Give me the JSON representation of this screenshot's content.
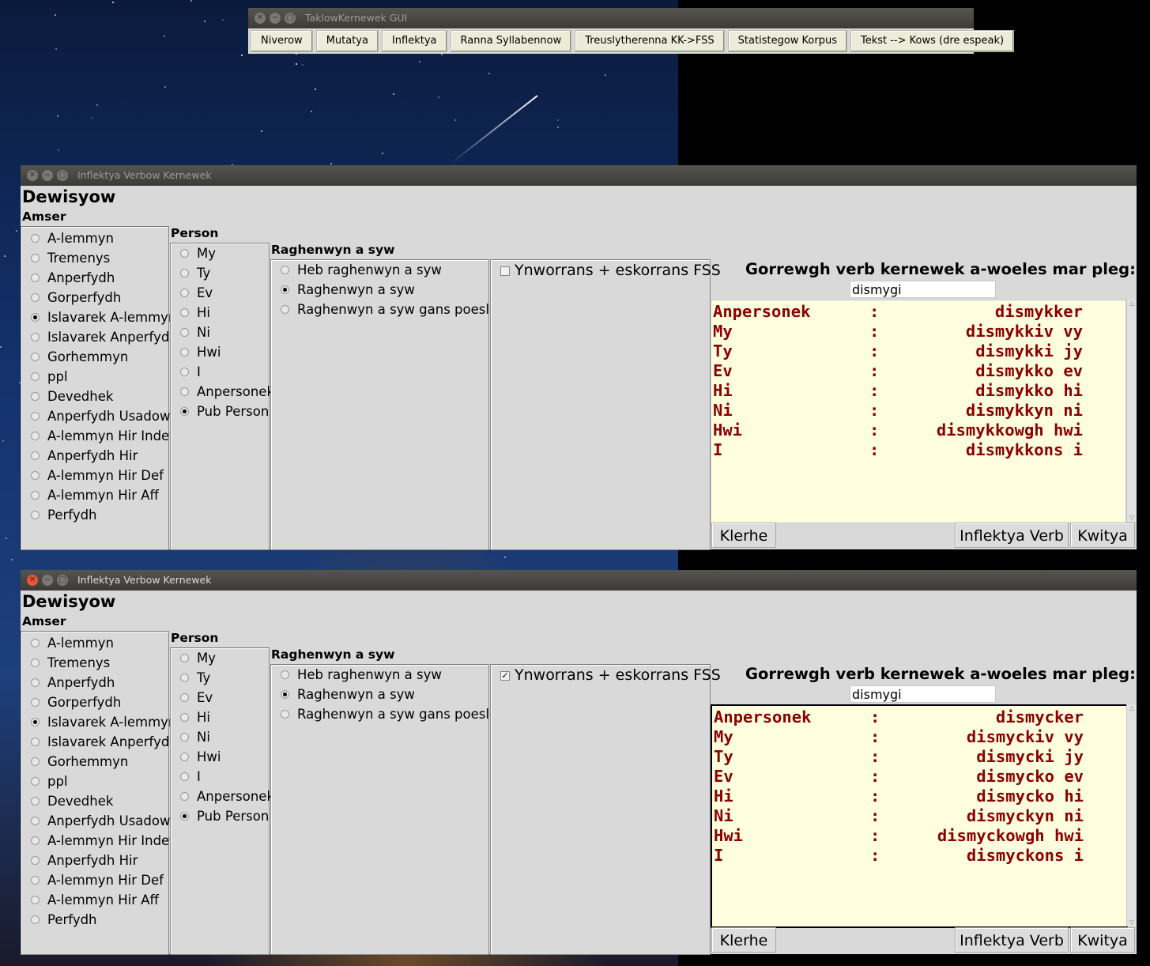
{
  "toolbar_window": {
    "title": "TaklowKernewek GUI",
    "buttons": [
      "Niverow",
      "Mutatya",
      "Inflektya",
      "Ranna Syllabennow",
      "Treuslytherenna KK->FSS",
      "Statistegow Korpus",
      "Tekst --> Kows (dre espeak)"
    ]
  },
  "windows": [
    {
      "title": "Inflektya Verbow Kernewek",
      "heading": "Dewisyow",
      "amser_label": "Amser",
      "amser_options": [
        "A-lemmyn",
        "Tremenys",
        "Anperfydh",
        "Gorperfydh",
        "Islavarek A-lemmyn",
        "Islavarek Anperfydh",
        "Gorhemmyn",
        "ppl",
        "Devedhek",
        "Anperfydh Usadow",
        "A-lemmyn Hir Indef",
        "Anperfydh Hir",
        "A-lemmyn Hir Def",
        "A-lemmyn Hir Aff",
        "Perfydh"
      ],
      "amser_selected": 4,
      "person_label": "Person",
      "person_options": [
        "My",
        "Ty",
        "Ev",
        "Hi",
        "Ni",
        "Hwi",
        "I",
        "Anpersonek",
        "Pub Person"
      ],
      "person_selected": 8,
      "raghenwyn_label": "Raghenwyn a syw",
      "raghenwyn_options": [
        "Heb raghenwyn a syw",
        "Raghenwyn a syw",
        "Raghenwyn a syw gans poeslev"
      ],
      "raghenwyn_selected": 1,
      "fss_label": "Ynworrans + eskorrans FSS",
      "fss_checked": false,
      "prompt": "Gorrewgh verb kernewek a-woeles mar pleg:",
      "verb_input": "dismygi",
      "output": [
        {
          "person": "Anpersonek",
          "sep": ":",
          "form": "dismykker"
        },
        {
          "person": "My",
          "sep": ":",
          "form": "dismykkiv vy"
        },
        {
          "person": "Ty",
          "sep": ":",
          "form": "dismykki jy"
        },
        {
          "person": "Ev",
          "sep": ":",
          "form": "dismykko ev"
        },
        {
          "person": "Hi",
          "sep": ":",
          "form": "dismykko hi"
        },
        {
          "person": "Ni",
          "sep": ":",
          "form": "dismykkyn ni"
        },
        {
          "person": "Hwi",
          "sep": ":",
          "form": "dismykkowgh hwi"
        },
        {
          "person": "I",
          "sep": ":",
          "form": "dismykkons i"
        }
      ],
      "buttons": {
        "clear": "Klerhe",
        "inflect": "Inflektya Verb",
        "quit": "Kwitya"
      }
    },
    {
      "title": "Inflektya Verbow Kernewek",
      "heading": "Dewisyow",
      "amser_label": "Amser",
      "amser_options": [
        "A-lemmyn",
        "Tremenys",
        "Anperfydh",
        "Gorperfydh",
        "Islavarek A-lemmyn",
        "Islavarek Anperfydh",
        "Gorhemmyn",
        "ppl",
        "Devedhek",
        "Anperfydh Usadow",
        "A-lemmyn Hir Indef",
        "Anperfydh Hir",
        "A-lemmyn Hir Def",
        "A-lemmyn Hir Aff",
        "Perfydh"
      ],
      "amser_selected": 4,
      "person_label": "Person",
      "person_options": [
        "My",
        "Ty",
        "Ev",
        "Hi",
        "Ni",
        "Hwi",
        "I",
        "Anpersonek",
        "Pub Person"
      ],
      "person_selected": 8,
      "raghenwyn_label": "Raghenwyn a syw",
      "raghenwyn_options": [
        "Heb raghenwyn a syw",
        "Raghenwyn a syw",
        "Raghenwyn a syw gans poeslev"
      ],
      "raghenwyn_selected": 1,
      "fss_label": "Ynworrans + eskorrans FSS",
      "fss_checked": true,
      "prompt": "Gorrewgh verb kernewek a-woeles mar pleg:",
      "verb_input": "dismygi",
      "output": [
        {
          "person": "Anpersonek",
          "sep": ":",
          "form": "dismycker"
        },
        {
          "person": "My",
          "sep": ":",
          "form": "dismyckiv vy"
        },
        {
          "person": "Ty",
          "sep": ":",
          "form": "dismycki jy"
        },
        {
          "person": "Ev",
          "sep": ":",
          "form": "dismycko ev"
        },
        {
          "person": "Hi",
          "sep": ":",
          "form": "dismycko hi"
        },
        {
          "person": "Ni",
          "sep": ":",
          "form": "dismyckyn ni"
        },
        {
          "person": "Hwi",
          "sep": ":",
          "form": "dismyckowgh hwi"
        },
        {
          "person": "I",
          "sep": ":",
          "form": "dismyckons i"
        }
      ],
      "buttons": {
        "clear": "Klerhe",
        "inflect": "Inflektya Verb",
        "quit": "Kwitya"
      }
    }
  ]
}
